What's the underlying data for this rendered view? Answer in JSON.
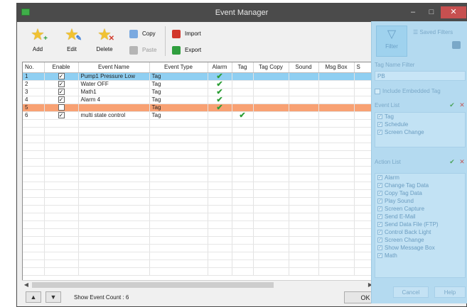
{
  "window": {
    "title": "Event Manager",
    "minimize": "–",
    "maximize": "□",
    "close": "✕"
  },
  "toolbar": {
    "add_label": "Add",
    "edit_label": "Edit",
    "delete_label": "Delete",
    "copy_label": "Copy",
    "paste_label": "Paste",
    "import_label": "Import",
    "export_label": "Export"
  },
  "table": {
    "headers": [
      "No.",
      "Enable",
      "Event Name",
      "Event Type",
      "Alarm",
      "Tag",
      "Tag Copy",
      "Sound",
      "Msg Box",
      "S"
    ],
    "rows": [
      {
        "no": "1",
        "enable": "✓",
        "name": "Pump1 Pressure Low",
        "type": "Tag",
        "alarm": "✔",
        "tag": ""
      },
      {
        "no": "2",
        "enable": "✓",
        "name": "Water OFF",
        "type": "Tag",
        "alarm": "✔",
        "tag": ""
      },
      {
        "no": "3",
        "enable": "✓",
        "name": "Math1",
        "type": "Tag",
        "alarm": "✔",
        "tag": ""
      },
      {
        "no": "4",
        "enable": "✓",
        "name": "Alarm 4",
        "type": "Tag",
        "alarm": "✔",
        "tag": ""
      },
      {
        "no": "5",
        "enable": "",
        "name": "",
        "type": "Tag",
        "alarm": "✔",
        "tag": ""
      },
      {
        "no": "6",
        "enable": "✓",
        "name": "multi state control",
        "type": "Tag",
        "alarm": "",
        "tag": "✔"
      }
    ]
  },
  "footer": {
    "up": "▲",
    "down": "▼",
    "count_text": "Show Event Count : 6",
    "ok_label": "OK"
  },
  "filter_panel": {
    "filter_label": "Filter",
    "saved_filters_label": "Saved Filters",
    "tag_name_filter_label": "Tag Name Filter",
    "tag_name_filter_value": "PB",
    "include_embedded_label": "Include Embedded Tag",
    "event_list_label": "Event List",
    "event_list": [
      "Tag",
      "Schedule",
      "Screen Change"
    ],
    "action_list_label": "Action List",
    "action_list": [
      "Alarm",
      "Change Tag Data",
      "Copy Tag Data",
      "Play Sound",
      "Screen Capture",
      "Send E-Mail",
      "Send Data File (FTP)",
      "Control Back Light",
      "Screen Change",
      "Show Message Box",
      "Math"
    ],
    "cancel_label": "Cancel",
    "help_label": "Help"
  }
}
